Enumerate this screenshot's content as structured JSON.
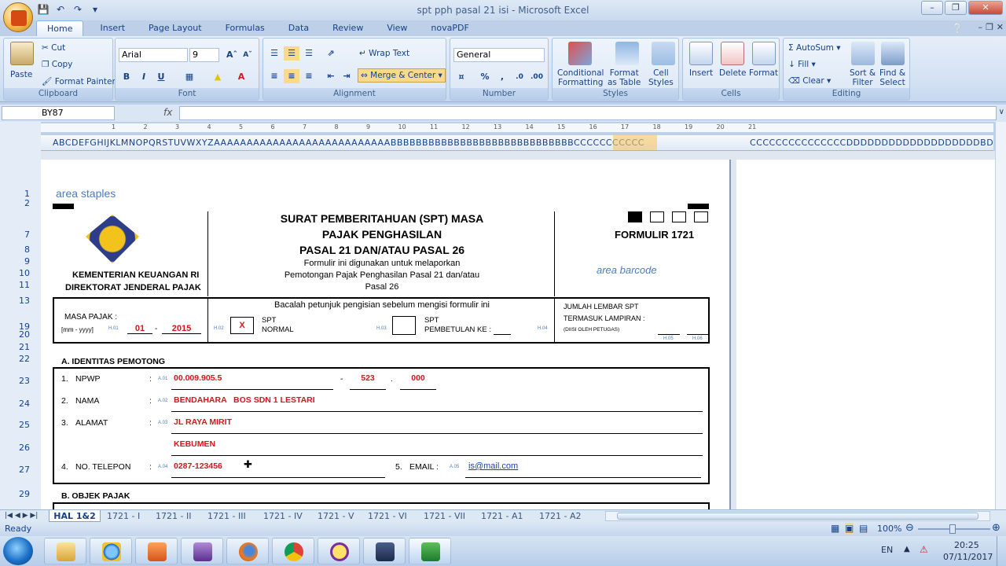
{
  "window": {
    "title": "spt pph pasal 21 isi - Microsoft Excel"
  },
  "ribbon_tabs": [
    "Home",
    "Insert",
    "Page Layout",
    "Formulas",
    "Data",
    "Review",
    "View",
    "novaPDF"
  ],
  "clipboard": {
    "paste": "Paste",
    "cut": "Cut",
    "copy": "Copy",
    "format_painter": "Format Painter",
    "label": "Clipboard"
  },
  "font": {
    "name": "Arial",
    "size": "9",
    "label": "Font",
    "bold": "B",
    "italic": "I",
    "underline": "U"
  },
  "alignment": {
    "wrap": "Wrap Text",
    "merge": "Merge & Center",
    "label": "Alignment"
  },
  "number": {
    "format": "General",
    "label": "Number",
    "percent": "%",
    "comma": ","
  },
  "styles": {
    "conditional": "Conditional",
    "conditional2": "Formatting",
    "format_table": "Format",
    "format_table2": "as Table",
    "cell_styles": "Cell",
    "cell_styles2": "Styles",
    "label": "Styles"
  },
  "cells": {
    "insert": "Insert",
    "delete": "Delete",
    "format": "Format",
    "label": "Cells"
  },
  "editing": {
    "autosum": "AutoSum",
    "fill": "Fill",
    "clear": "Clear",
    "sort": "Sort &",
    "sort2": "Filter",
    "find": "Find &",
    "find2": "Select",
    "label": "Editing"
  },
  "formula_bar": {
    "name_box": "BY87",
    "fx": "fx",
    "value": ""
  },
  "column_headers": "ABCDEFGHIJKLMNOPQRSTUVWXYZAAAAAAAAAAAAAAAAAAAAAAAAAAABBBBBBBBBBBBBBBBBBBBBBBBBBBBBCCCCCCCCCCC",
  "column_headers2": "CCCCCCCCCCCCCCCDDDDDDDDDDDDDDDDDDDBDDDDD",
  "ruler": [
    "1",
    "2",
    "3",
    "4",
    "5",
    "6",
    "7",
    "8",
    "9",
    "10",
    "11",
    "12",
    "13",
    "14",
    "15",
    "16",
    "17",
    "18",
    "19",
    "20",
    "21"
  ],
  "row_numbers": [
    "1",
    "2",
    "7",
    "8",
    "9",
    "10",
    "11",
    "13",
    "19",
    "20",
    "21",
    "22",
    "23",
    "24",
    "25",
    "26",
    "27",
    "29"
  ],
  "form": {
    "area_staples": "area staples",
    "ministry1": "KEMENTERIAN KEUANGAN RI",
    "ministry2": "DIREKTORAT JENDERAL PAJAK",
    "title1": "SURAT PEMBERITAHUAN (SPT) MASA",
    "title2": "PAJAK PENGHASILAN",
    "title3": "PASAL 21 DAN/ATAU PASAL 26",
    "sub1": "Formulir ini digunakan untuk melaporkan",
    "sub2": "Pemotongan Pajak Penghasilan Pasal 21 dan/atau",
    "sub3": "Pasal 26",
    "formulir": "FORMULIR 1721",
    "area_barcode": "area barcode",
    "bacalah": "Bacalah petunjuk pengisian sebelum mengisi formulir ini",
    "masa_pajak": "MASA PAJAK :",
    "mm_yyyy": "[mm - yyyy]",
    "h01": "H.01",
    "month": "01",
    "dash": "-",
    "year": "2015",
    "h02": "H.02",
    "x": "X",
    "spt": "SPT",
    "normal": "NORMAL",
    "h03": "H.03",
    "spt2": "SPT",
    "pembetulan": "PEMBETULAN KE :",
    "h04": "H.04",
    "jumlah1": "JUMLAH LEMBAR SPT",
    "jumlah2": "TERMASUK LAMPIRAN :",
    "diisi": "(DIISI OLEH PETUGAS)",
    "h05": "H.05",
    "h06": "H.06",
    "section_a": "A. IDENTITAS PEMOTONG",
    "n1": "1.",
    "npwp": "NPWP",
    "colon": ":",
    "a01": "A.01",
    "npwp_val": "00.009.905.5",
    "npwp_dash": "-",
    "npwp2": "523",
    "npwp_dot": ".",
    "npwp3": "000",
    "n2": "2.",
    "nama": "NAMA",
    "a02": "A.02",
    "nama_val": "BENDAHARA   BOS SDN 1 LESTARI",
    "n3": "3.",
    "alamat": "ALAMAT",
    "a03": "A.03",
    "alamat_val": "JL RAYA MIRIT",
    "alamat_val2": "KEBUMEN",
    "n4": "4.",
    "telepon": "NO. TELEPON",
    "a04": "A.04",
    "telepon_val": "0287-123456",
    "n5": "5.",
    "email": "EMAIL :",
    "a05": "A.05",
    "email_val": "is@mail.com",
    "section_b": "B. OBJEK PAJAK"
  },
  "sheet_tabs": [
    "HAL 1&2",
    "1721 - I",
    "1721 - II",
    "1721 - III",
    "1721 - IV",
    "1721 - V",
    "1721 - VI",
    "1721 - VII",
    "1721 - A1",
    "1721 - A2"
  ],
  "status": {
    "ready": "Ready",
    "zoom": "100%"
  },
  "taskbar": {
    "lang": "EN",
    "time": "20:25",
    "date": "07/11/2017"
  }
}
